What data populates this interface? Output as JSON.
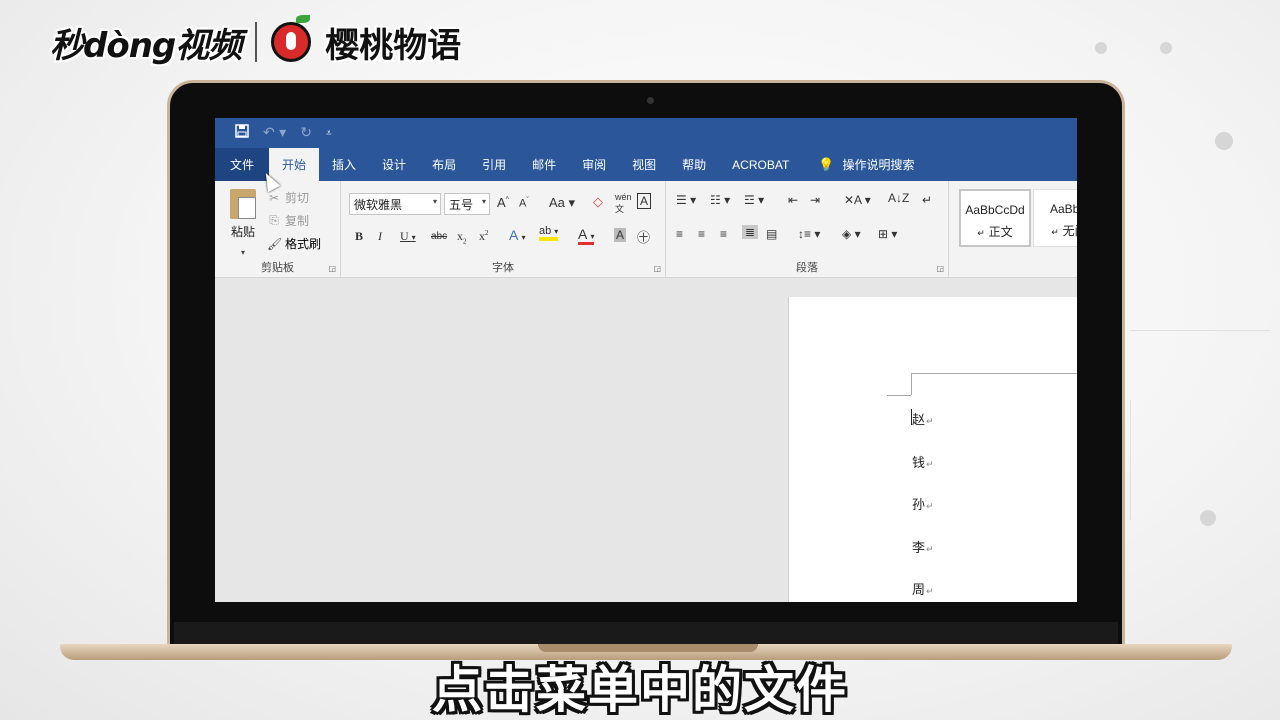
{
  "brand": {
    "left": "秒dòng视频",
    "right": "樱桃物语"
  },
  "qat": {
    "save_icon": "save-icon",
    "undo_icon": "undo-icon",
    "redo_icon": "redo-icon",
    "customize_icon": "customize-icon"
  },
  "tabs": [
    {
      "label": "文件"
    },
    {
      "label": "开始"
    },
    {
      "label": "插入"
    },
    {
      "label": "设计"
    },
    {
      "label": "布局"
    },
    {
      "label": "引用"
    },
    {
      "label": "邮件"
    },
    {
      "label": "审阅"
    },
    {
      "label": "视图"
    },
    {
      "label": "帮助"
    },
    {
      "label": "ACROBAT"
    },
    {
      "label": "操作说明搜索"
    }
  ],
  "ribbon": {
    "clipboard": {
      "paste": "粘贴",
      "cut": "剪切",
      "copy": "复制",
      "format_painter": "格式刷",
      "label": "剪贴板"
    },
    "font": {
      "name": "微软雅黑",
      "size": "五号",
      "label": "字体"
    },
    "paragraph": {
      "label": "段落"
    },
    "styles": [
      {
        "sample": "AaBbCcDd",
        "name": "正文"
      },
      {
        "sample": "AaBbC",
        "name": "无间"
      }
    ]
  },
  "document": {
    "lines": [
      "赵",
      "钱",
      "孙",
      "李",
      "周"
    ]
  },
  "subtitle": "点击菜单中的文件"
}
